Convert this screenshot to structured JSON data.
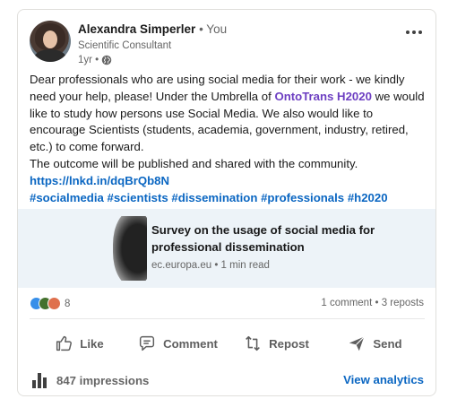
{
  "author": {
    "name": "Alexandra Simperler",
    "relation": "• You",
    "headline": "Scientific Consultant",
    "age": "1yr •"
  },
  "post": {
    "line1": "Dear professionals who are using social media for their work - we kindly",
    "line2": "need your help, please! Under the Umbrella of ",
    "mention": "OntoTrans H2020",
    "line2_end": " we would",
    "line3": "like to study how persons use Social Media. We also would like to",
    "line4": "encourage Scientists (students, academia, government, industry, retired,",
    "line5": "etc.) to come forward.",
    "line6": "The outcome will be published and shared with the community.",
    "short_link": "https://lnkd.in/dqBrQb8N",
    "hashtags": [
      "#socialmedia",
      "#scientists",
      "#dissemination",
      "#professionals",
      "#h2020"
    ]
  },
  "article": {
    "title_line1": "Survey on the usage of social media for",
    "title_line2": "professional dissemination",
    "source": "ec.europa.eu • 1 min read"
  },
  "social": {
    "reaction_count": "8",
    "comments_reposts": "1 comment • 3 reposts"
  },
  "actions": {
    "like": "Like",
    "comment": "Comment",
    "repost": "Repost",
    "send": "Send"
  },
  "footer": {
    "impressions": "847 impressions",
    "view_analytics": "View analytics"
  },
  "colors": {
    "link": "#0a66c2",
    "mention": "#6d3fc2",
    "article_bg": "#edf3f8"
  },
  "icons": [
    "more-options-icon",
    "globe-icon",
    "like-icon",
    "comment-icon",
    "repost-icon",
    "send-icon",
    "analytics-bar-icon"
  ]
}
